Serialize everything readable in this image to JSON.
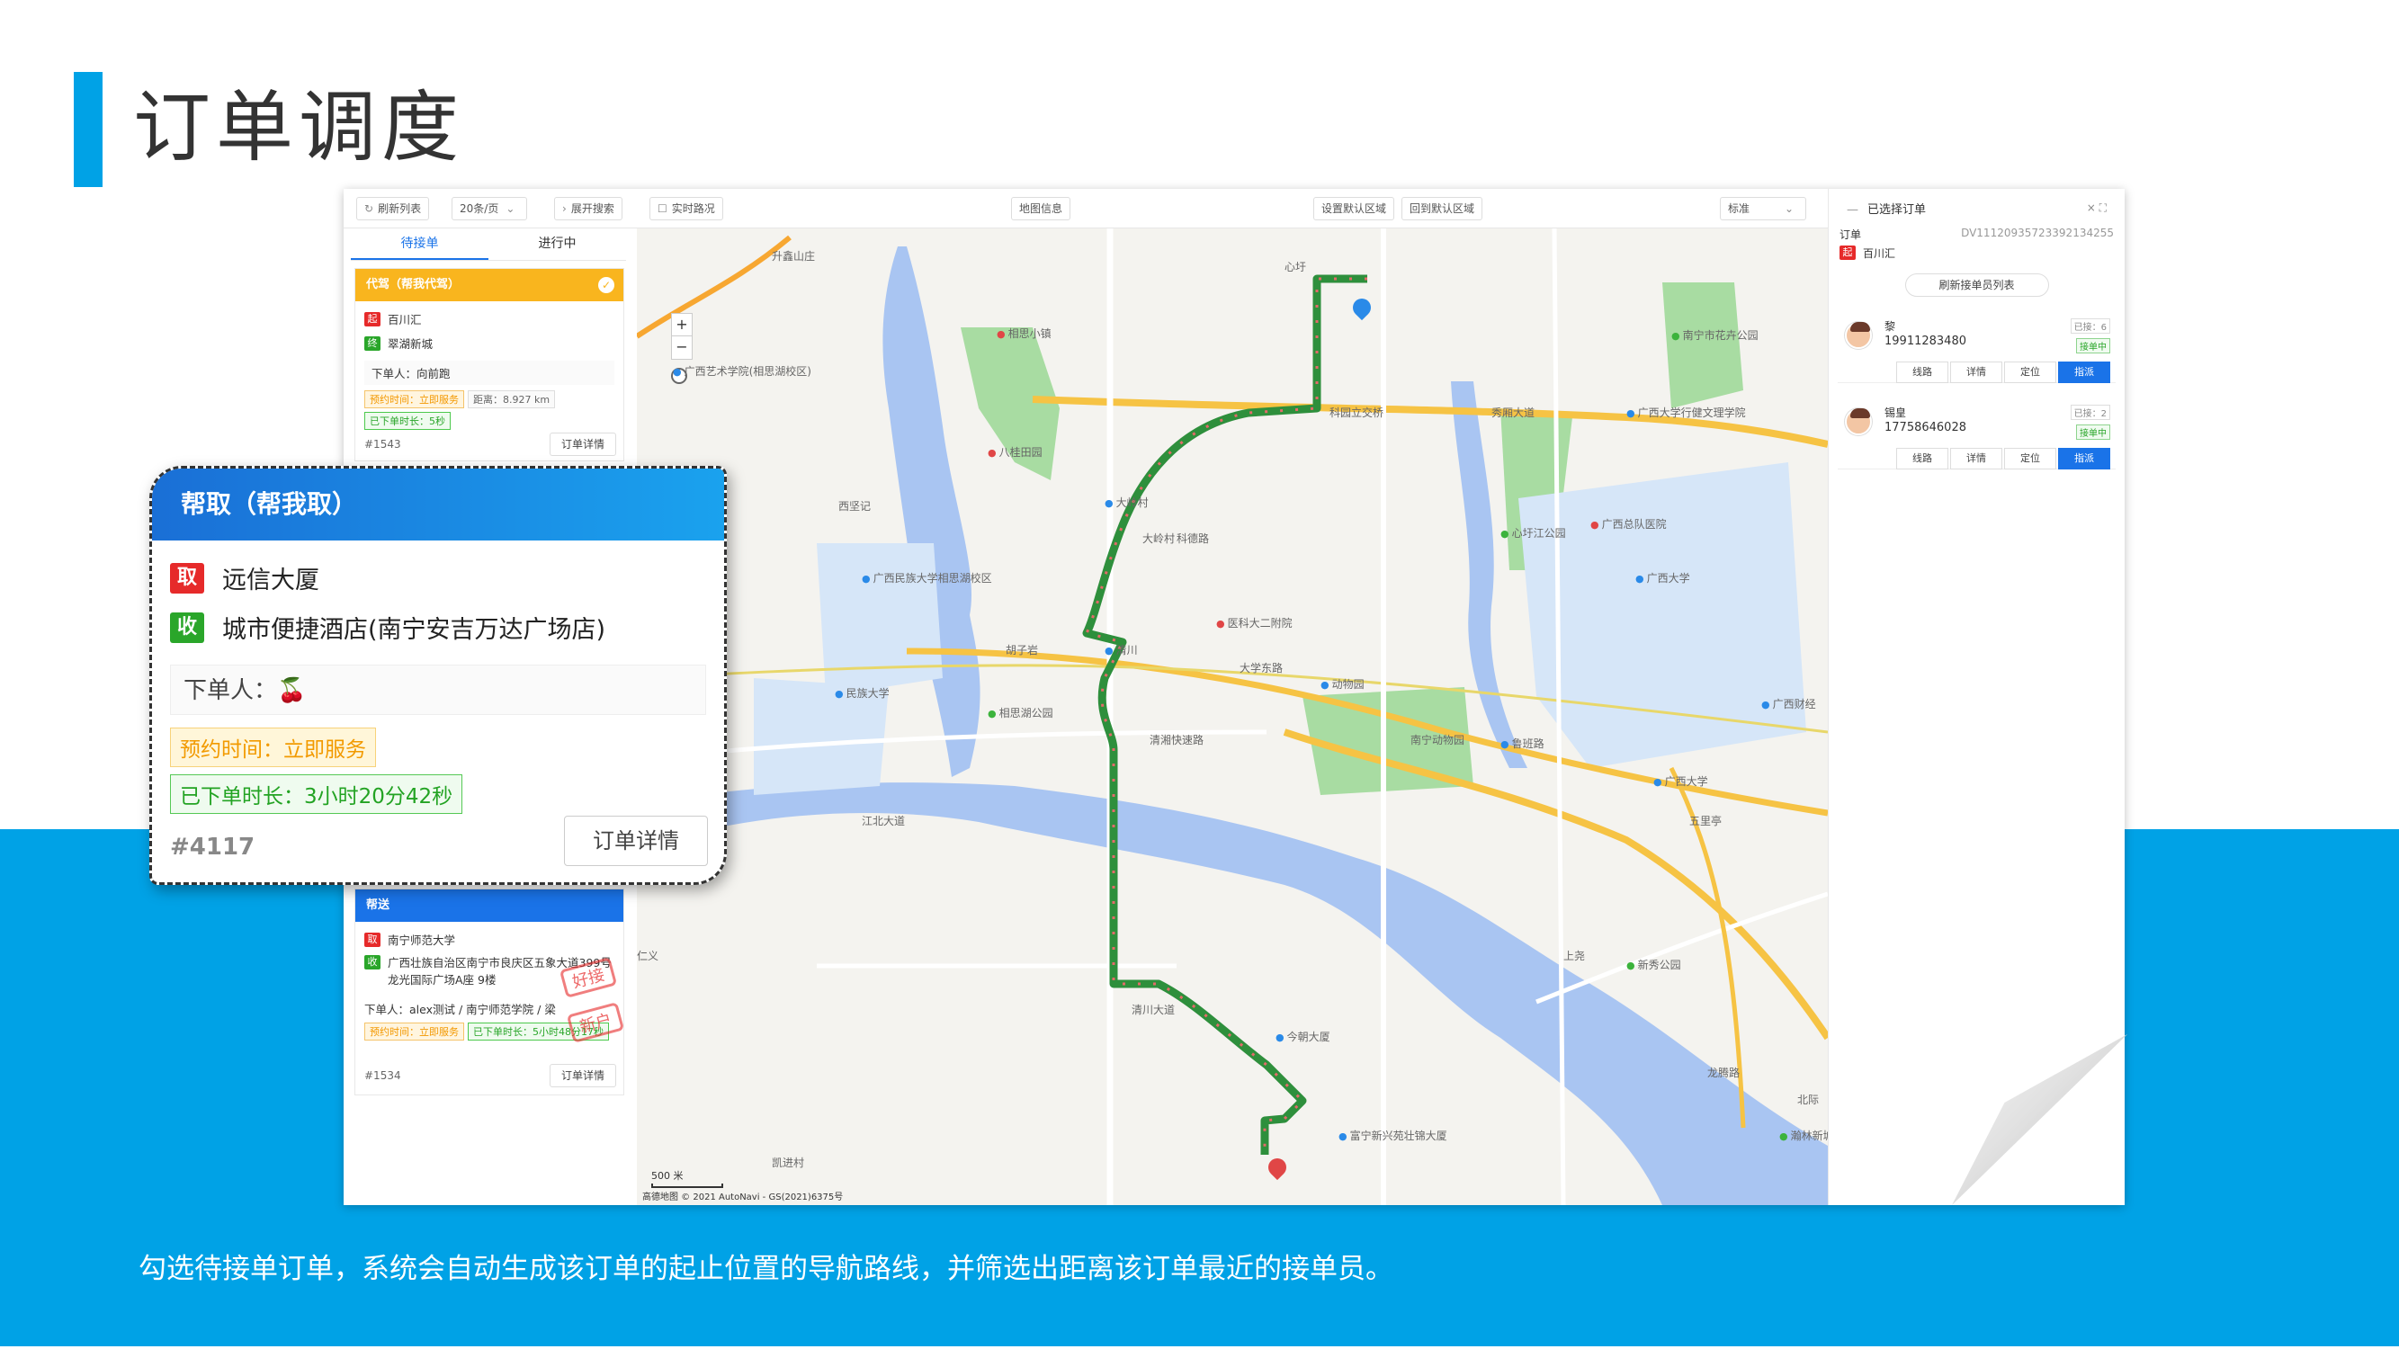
{
  "slide": {
    "title": "订单调度",
    "caption": "勾选待接单订单，系统会自动生成该订单的起止位置的导航路线，并筛选出距离该订单最近的接单员。"
  },
  "toolbar": {
    "refresh": "刷新列表",
    "page_size": "20条/页",
    "expand_search": "展开搜索",
    "traffic": "实时路况",
    "map_info": "地图信息",
    "set_default_area": "设置默认区域",
    "goto_default_area": "回到默认区域",
    "map_style": "标准"
  },
  "tabs": {
    "pending": "待接单",
    "in_progress": "进行中"
  },
  "card1": {
    "type": "代驾（帮我代驾）",
    "pickup_tag": "起",
    "pickup": "百川汇",
    "dropoff_tag": "终",
    "dropoff": "翠湖新城",
    "buyer": "下单人：向前跑",
    "appointment": "预约时间：立即服务",
    "distance": "距离：8.927 km",
    "elapsed": "已下单时长：5秒",
    "id": "#1543",
    "detail": "订单详情"
  },
  "card2": {
    "type": "帮送",
    "pickup_tag": "取",
    "pickup": "南宁师范大学",
    "dropoff_tag": "收",
    "dropoff": "广西壮族自治区南宁市良庆区五象大道399号龙光国际广场A座 9楼",
    "buyer": "下单人：alex测试 / 南宁师范学院 / 梁",
    "appointment": "预约时间：立即服务",
    "elapsed": "已下单时长：5小时48分17秒",
    "id": "#1534",
    "detail": "订单详情",
    "stamp1": "好接",
    "stamp2": "新户"
  },
  "popup": {
    "type": "帮取（帮我取）",
    "pickup_tag": "取",
    "pickup": "远信大厦",
    "dropoff_tag": "收",
    "dropoff": "城市便捷酒店(南宁安吉万达广场店)",
    "buyer": "下单人：🍒",
    "appointment": "预约时间：立即服务",
    "elapsed": "已下单时长：3小时20分42秒",
    "id": "#4117",
    "detail": "订单详情"
  },
  "right_panel": {
    "title": "已选择订单",
    "order_label": "订单",
    "order_no": "DV111209357233921342​55",
    "start_tag": "起",
    "start": "百川汇",
    "refresh_couriers": "刷新接单员列表",
    "couriers": [
      {
        "name": "黎",
        "phone": "19911283480",
        "count": "已接：6",
        "status": "接单中",
        "btn_route": "线路",
        "btn_detail": "详情",
        "btn_locate": "定位",
        "btn_assign": "指派"
      },
      {
        "name": "锡皇",
        "phone": "17758646028",
        "count": "已接：2",
        "status": "接单中",
        "btn_route": "线路",
        "btn_detail": "详情",
        "btn_locate": "定位",
        "btn_assign": "指派"
      }
    ]
  },
  "map": {
    "labels": [
      {
        "t": "升鑫山庄",
        "c": "map-label"
      },
      {
        "t": "相思小镇",
        "c": "map-label poi-r"
      },
      {
        "t": "广西艺术学院(相思湖校区)",
        "c": "map-label poi"
      },
      {
        "t": "八桂田园",
        "c": "map-label poi-r"
      },
      {
        "t": "西坚记",
        "c": "map-label"
      },
      {
        "t": "大岭村",
        "c": "map-label poi"
      },
      {
        "t": "科德路",
        "c": "map-label"
      },
      {
        "t": "大岭村",
        "c": "map-label"
      },
      {
        "t": "广西民族大学相思湖校区",
        "c": "map-label poi"
      },
      {
        "t": "医科大二附院",
        "c": "map-label poi-r"
      },
      {
        "t": "清川",
        "c": "map-label poi"
      },
      {
        "t": "胡子岩",
        "c": "map-label"
      },
      {
        "t": "民族大学",
        "c": "map-label poi"
      },
      {
        "t": "相思湖公园",
        "c": "map-label poi-g"
      },
      {
        "t": "大学东路",
        "c": "map-label"
      },
      {
        "t": "动物园",
        "c": "map-label poi"
      },
      {
        "t": "清湘快速路",
        "c": "map-label"
      },
      {
        "t": "江北大道",
        "c": "map-label"
      },
      {
        "t": "心圩",
        "c": "map-label"
      },
      {
        "t": "科园立交桥",
        "c": "map-label"
      },
      {
        "t": "秀厢大道",
        "c": "map-label"
      },
      {
        "t": "广西大学行健文理学院",
        "c": "map-label poi"
      },
      {
        "t": "南宁市花卉公园",
        "c": "map-label poi-g"
      },
      {
        "t": "心圩江公园",
        "c": "map-label poi-g"
      },
      {
        "t": "广西总队医院",
        "c": "map-label poi-r"
      },
      {
        "t": "广西大学",
        "c": "map-label poi"
      },
      {
        "t": "鲁班路",
        "c": "map-label poi"
      },
      {
        "t": "广西大学",
        "c": "map-label poi"
      },
      {
        "t": "广西财经",
        "c": "map-label poi"
      },
      {
        "t": "五里亭",
        "c": "map-label"
      },
      {
        "t": "上尧",
        "c": "map-label"
      },
      {
        "t": "新秀公园",
        "c": "map-label poi-g"
      },
      {
        "t": "今朝大厦",
        "c": "map-label poi"
      },
      {
        "t": "富宁新兴苑壮锦大厦",
        "c": "map-label poi"
      },
      {
        "t": "龙腾路",
        "c": "map-label"
      },
      {
        "t": "北际",
        "c": "map-label"
      },
      {
        "t": "瀚林新城",
        "c": "map-label poi-g"
      },
      {
        "t": "清川大道",
        "c": "map-label"
      },
      {
        "t": "凯进村",
        "c": "map-label"
      },
      {
        "t": "仁义",
        "c": "map-label"
      },
      {
        "t": "南宁动物园",
        "c": "map-label"
      }
    ],
    "scale": "500 米",
    "credit": "高德地图 © 2021 AutoNavi - GS(2021)6375号",
    "zoom_in": "+",
    "zoom_out": "−"
  }
}
